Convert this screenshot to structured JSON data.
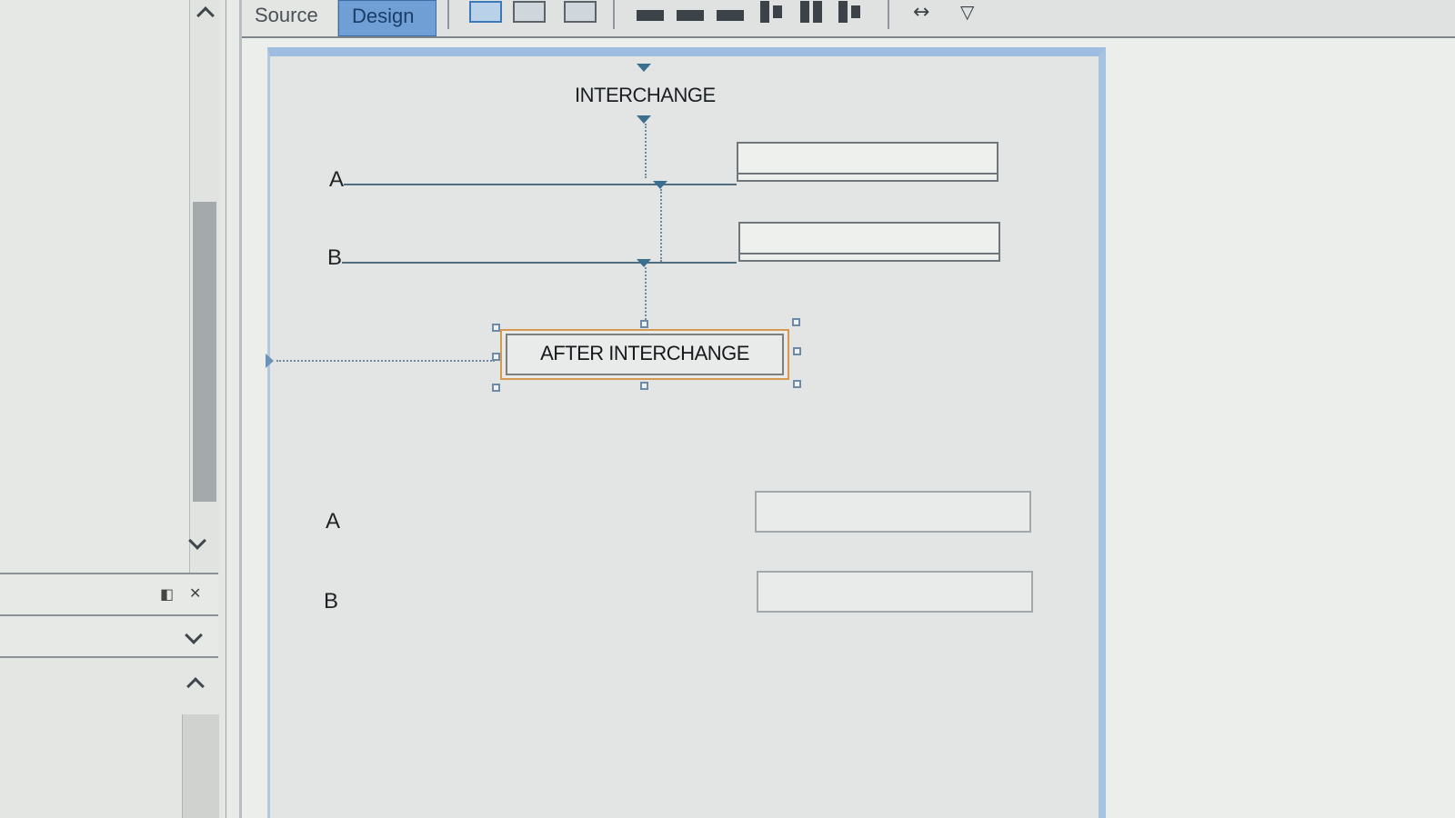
{
  "tabs": {
    "source": "Source",
    "design": "Design"
  },
  "canvas": {
    "title": "INTERCHANGE",
    "before": {
      "label_a": "A",
      "label_b": "B"
    },
    "selected_button": "AFTER INTERCHANGE",
    "after": {
      "label_a": "A",
      "label_b": "B"
    }
  },
  "colors": {
    "design_tab": "#6f9fd4",
    "selection": "#d59a4f",
    "canvas_border": "#9fbde0"
  },
  "icons": [
    "chevron-up-icon",
    "chevron-down-icon",
    "panel-collapse-icon",
    "close-icon"
  ]
}
